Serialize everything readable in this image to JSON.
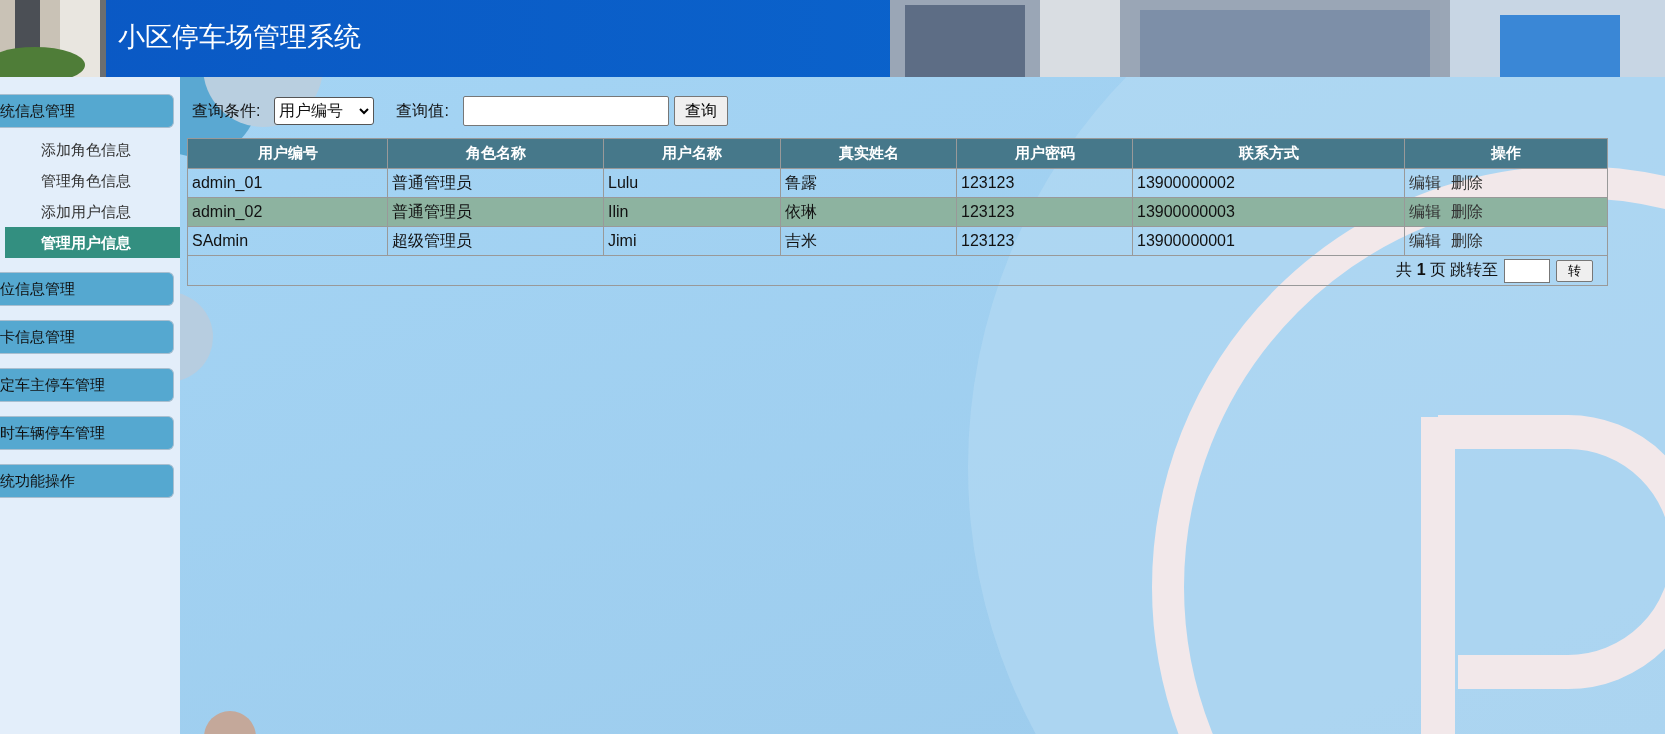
{
  "header": {
    "title": "小区停车场管理系统"
  },
  "sidebar": {
    "groups": [
      {
        "label": "统信息管理",
        "items": [
          {
            "label": "添加角色信息",
            "selected": false
          },
          {
            "label": "管理角色信息",
            "selected": false
          },
          {
            "label": "添加用户信息",
            "selected": false
          },
          {
            "label": "管理用户信息",
            "selected": true
          }
        ]
      },
      {
        "label": "位信息管理"
      },
      {
        "label": "卡信息管理"
      },
      {
        "label": "定车主停车管理"
      },
      {
        "label": "时车辆停车管理"
      },
      {
        "label": "统功能操作"
      }
    ]
  },
  "query": {
    "condition_label": "查询条件:",
    "condition_value": "用户编号",
    "value_label": "查询值:",
    "button": "查询"
  },
  "table": {
    "columns": [
      "用户编号",
      "角色名称",
      "用户名称",
      "真实姓名",
      "用户密码",
      "联系方式",
      "操作"
    ],
    "rows": [
      {
        "selected": false,
        "cells": [
          "admin_01",
          "普通管理员",
          "Lulu",
          "鲁露",
          "123123",
          "13900000002"
        ],
        "actions": [
          "编辑",
          "删除"
        ]
      },
      {
        "selected": true,
        "cells": [
          "admin_02",
          "普通管理员",
          "Ilin",
          "依琳",
          "123123",
          "13900000003"
        ],
        "actions": [
          "编辑",
          "删除"
        ]
      },
      {
        "selected": false,
        "cells": [
          "SAdmin",
          "超级管理员",
          "Jimi",
          "吉米",
          "123123",
          "13900000001"
        ],
        "actions": [
          "编辑",
          "删除"
        ]
      }
    ],
    "pager": {
      "prefix": "共",
      "pages": "1",
      "suffix": "页",
      "jump_label": "跳转至",
      "button": "转"
    }
  }
}
